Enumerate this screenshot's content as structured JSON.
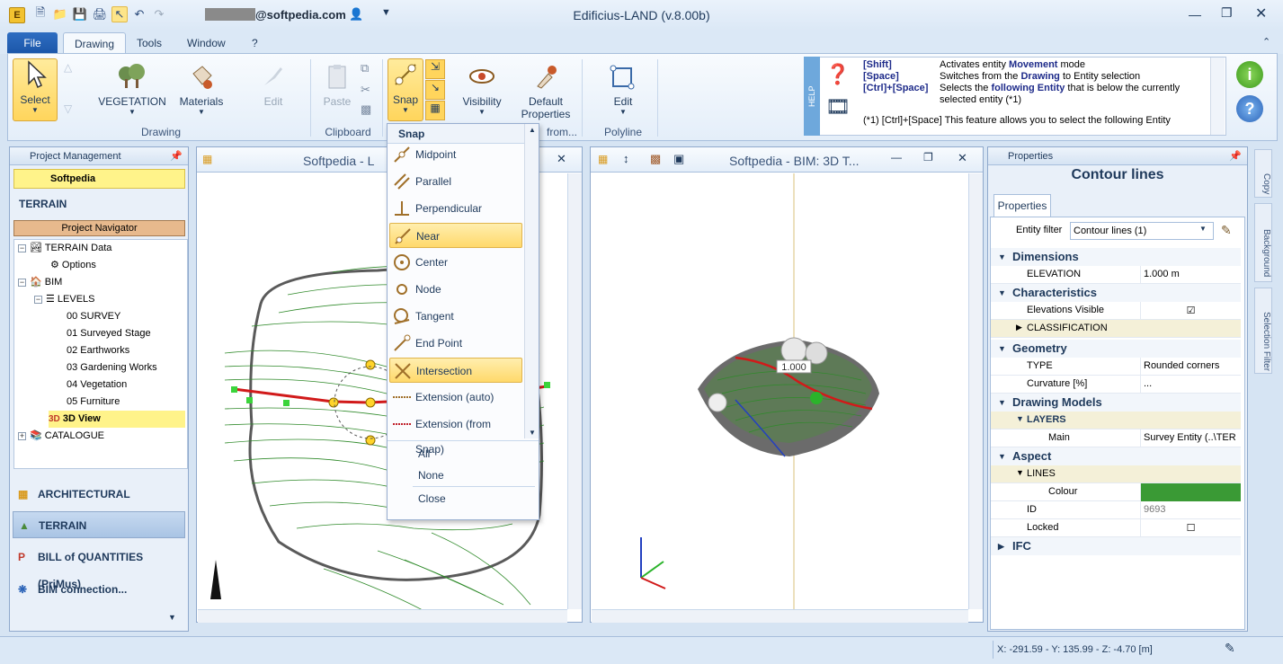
{
  "app": {
    "title": "Edificius-LAND (v.8.00b)",
    "user": "@softpedia.com"
  },
  "menu": {
    "file": "File",
    "tabs": [
      "Drawing",
      "Tools",
      "Window",
      "?"
    ]
  },
  "ribbon": {
    "select": "Select",
    "vegetation": "VEGETATION",
    "materials": "Materials",
    "edit_disabled": "Edit",
    "group_drawing": "Drawing",
    "paste": "Paste",
    "group_clipboard": "Clipboard",
    "snap": "Snap",
    "visibility": "Visibility",
    "default_props_1": "Default",
    "default_props_2": "Properties",
    "from": "from...",
    "edit": "Edit",
    "group_polyline": "Polyline"
  },
  "help": {
    "tab": "HELP",
    "rows": [
      {
        "key": "[Shift]",
        "text": "Activates entity ",
        "b": "Movement",
        "rest": " mode"
      },
      {
        "key": "[Space]",
        "text": "Switches from the ",
        "b": "Drawing",
        "rest": " to Entity selection"
      },
      {
        "key": "[Ctrl]+[Space]",
        "text": "Selects the ",
        "b": "following Entity",
        "rest": " that is below the currently selected entity (*1)"
      }
    ],
    "footnote": "(*1)  [Ctrl]+[Space] This feature allows you to select the following Entity"
  },
  "project": {
    "header": "Project Management",
    "project_name": "Softpedia",
    "terrain_label": "TERRAIN",
    "navigator": "Project Navigator",
    "tree": [
      "TERRAIN Data",
      "Options",
      "BIM",
      "LEVELS",
      "00 SURVEY",
      "01 Surveyed Stage",
      "02 Earthworks",
      "03 Gardening Works",
      "04 Vegetation",
      "05 Furniture",
      "3D View",
      "CATALOGUE"
    ],
    "modules": [
      "ARCHITECTURAL",
      "TERRAIN",
      "BILL of QUANTITIES (PriMus)",
      "BIM connection..."
    ]
  },
  "views": {
    "left_title": "Softpedia - L",
    "right_title": "Softpedia -  BIM: 3D T...",
    "elevation_label": "1.000"
  },
  "snap_menu": {
    "header": "Snap",
    "items": [
      "Midpoint",
      "Parallel",
      "Perpendicular",
      "Near",
      "Center",
      "Node",
      "Tangent",
      "End Point",
      "Intersection",
      "Extension (auto)",
      "Extension (from Snap)"
    ],
    "actions": [
      "All",
      "None",
      "Close"
    ]
  },
  "properties": {
    "header": "Properties",
    "title": "Contour lines",
    "tab": "Properties",
    "filter_label": "Entity filter",
    "filter_value": "Contour lines (1)",
    "cat_dimensions": "Dimensions",
    "elevation_k": "ELEVATION",
    "elevation_v": "1.000 m",
    "cat_characteristics": "Characteristics",
    "elev_visible_k": "Elevations Visible",
    "classification": "CLASSIFICATION",
    "cat_geometry": "Geometry",
    "type_k": "TYPE",
    "type_v": "Rounded corners",
    "curv_k": "Curvature [%]",
    "curv_v": "...",
    "cat_drawing_models": "Drawing Models",
    "layers": "LAYERS",
    "main_k": "Main",
    "main_v": "Survey Entity   (..\\TER",
    "cat_aspect": "Aspect",
    "lines": "LINES",
    "colour_k": "Colour",
    "colour_v": "#3a9a35",
    "id_k": "ID",
    "id_v": "9693",
    "locked_k": "Locked",
    "cat_ifc": "IFC"
  },
  "side_tabs": [
    "Copy",
    "Background",
    "Selection Filter"
  ],
  "status": {
    "coords": "X: -291.59 - Y: 135.99 - Z: -4.70 [m]"
  },
  "colors": {
    "accent": "#1b56a8",
    "highlight": "#ffd96b",
    "contour": "#2f8a2a",
    "selected_line": "#d11a1a"
  }
}
